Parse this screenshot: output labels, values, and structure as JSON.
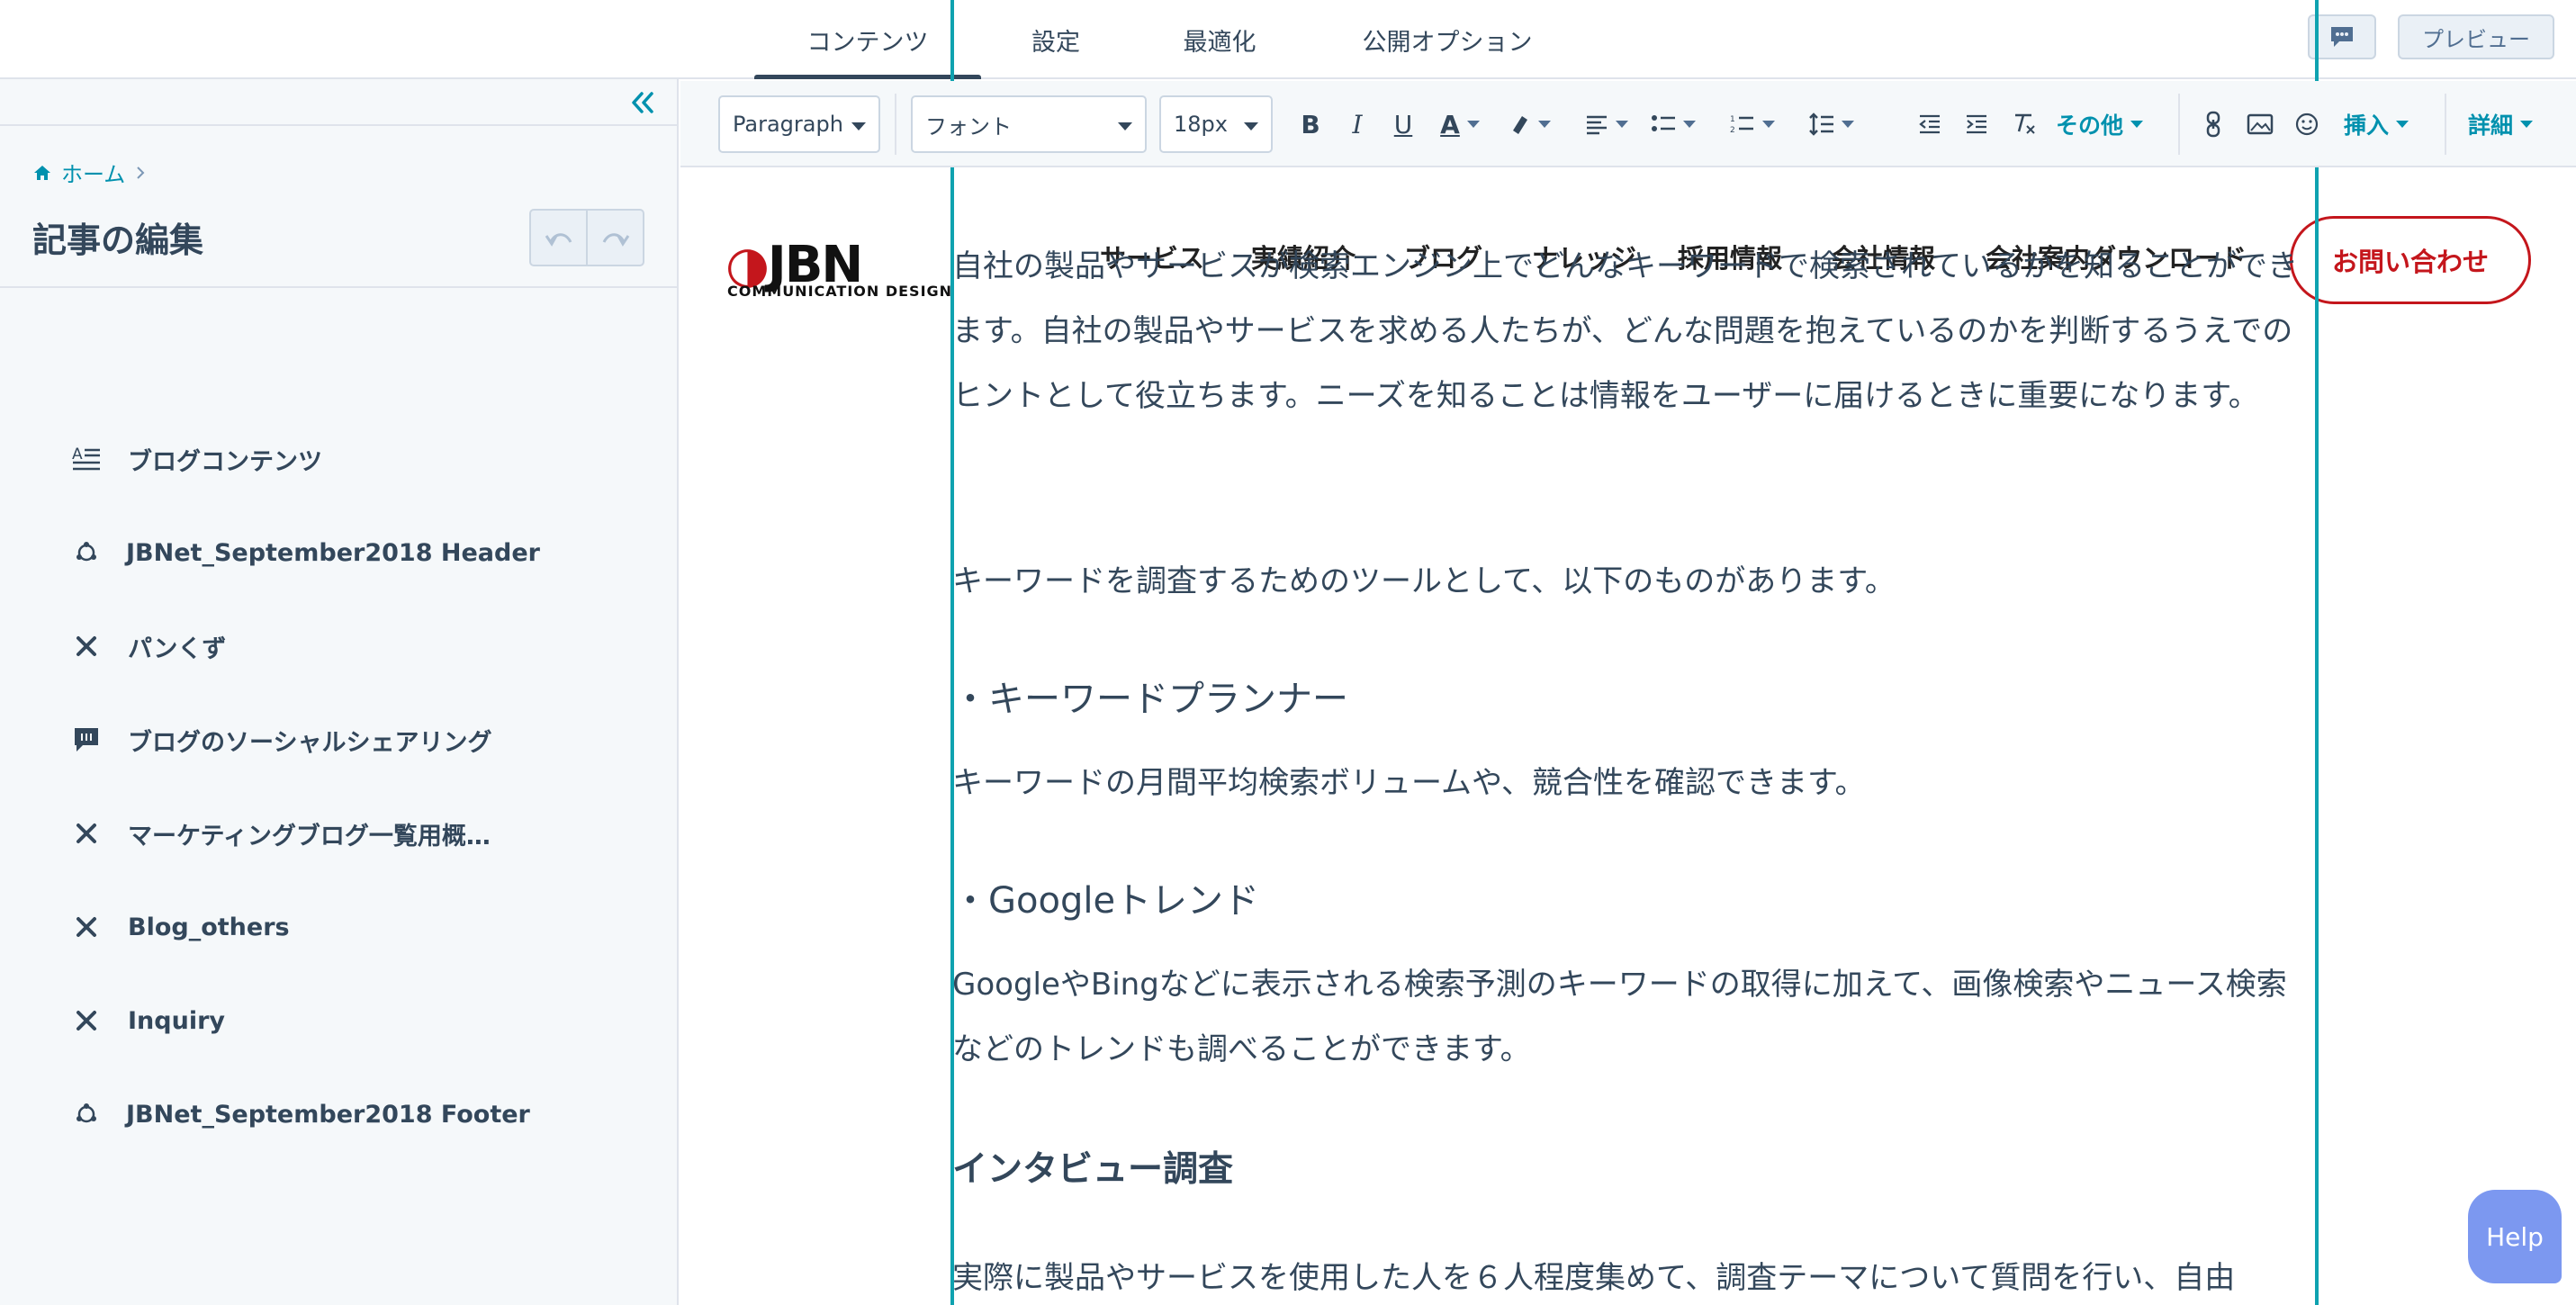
{
  "top_nav": {
    "tabs": [
      {
        "label": "コンテンツ",
        "active": true
      },
      {
        "label": "設定"
      },
      {
        "label": "最適化"
      },
      {
        "label": "公開オプション"
      }
    ],
    "comment_icon": "comment-icon",
    "preview_label": "プレビュー"
  },
  "sidebar": {
    "collapse_icon": "double-chevron-left-icon",
    "breadcrumb": {
      "home": "ホーム",
      "separator_icon": "chevron-right-icon"
    },
    "title": "記事の編集",
    "undo_icon": "undo-icon",
    "redo_icon": "redo-icon",
    "modules": [
      {
        "label": "ブログコンテンツ",
        "icon": "rich-text-icon"
      },
      {
        "label": "JBNet_September2018 Header",
        "icon": "global-module-icon"
      },
      {
        "label": "パンくず",
        "icon": "custom-module-icon"
      },
      {
        "label": "ブログのソーシャルシェアリング",
        "icon": "social-sharing-icon"
      },
      {
        "label": "マーケティングブログ一覧用概…",
        "icon": "custom-module-icon"
      },
      {
        "label": "Blog_others",
        "icon": "custom-module-icon"
      },
      {
        "label": "Inquiry",
        "icon": "custom-module-icon"
      },
      {
        "label": "JBNet_September2018 Footer",
        "icon": "global-module-icon"
      }
    ]
  },
  "toolbar": {
    "block_style": "Paragraph",
    "font": "フォント",
    "font_size": "18px",
    "more_label": "その他",
    "insert_label": "挿入",
    "advanced_label": "詳細"
  },
  "site": {
    "logo_text": "JBN",
    "logo_sub": "COMMUNICATION DESIGN",
    "nav": [
      "サービス",
      "実績紹介",
      "ブログ",
      "ナレッジ",
      "採用情報",
      "会社情報",
      "会社案内ダウンロード"
    ],
    "contact": "お問い合わせ"
  },
  "article": {
    "p1": "自社の製品やサービスが検索エンジン上でどんなキーワードで検索されているかを知ることができます。自社の製品やサービスを求める人たちが、どんな問題を抱えているのかを判断するうえでのヒントとして役立ちます。ニーズを知ることは情報をユーザーに届けるときに重要になります。",
    "p2": "キーワードを調査するためのツールとして、以下のものがあります。",
    "b1": "・キーワードプランナー",
    "p3": "キーワードの月間平均検索ボリュームや、競合性を確認できます。",
    "b2": "・Googleトレンド",
    "p4": "GoogleやBingなどに表示される検索予測のキーワードの取得に加えて、画像検索やニュース検索などのトレンドも調べることができます。",
    "h3": "インタビュー調査",
    "p5": "実際に製品やサービスを使用した人を６人程度集めて、調査テーマについて質問を行い、自由"
  },
  "help_label": "Help"
}
